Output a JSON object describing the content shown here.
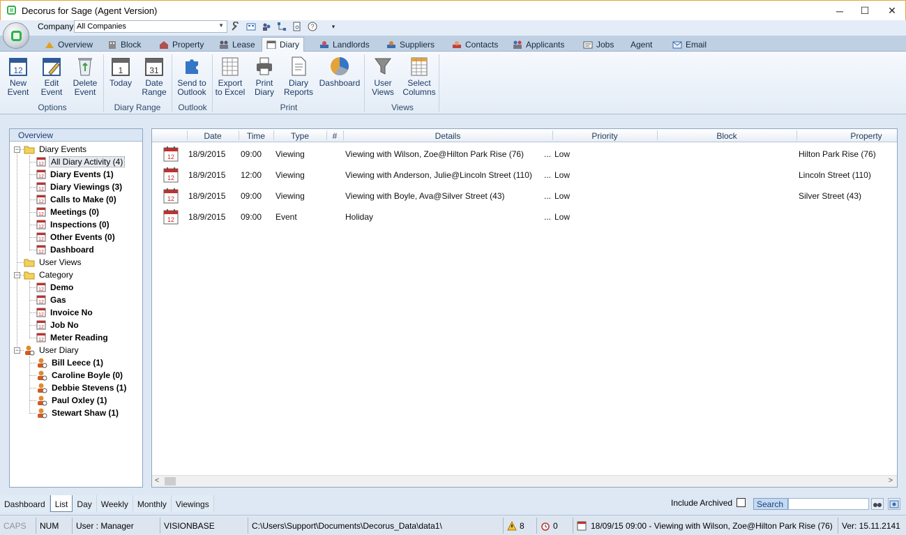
{
  "window": {
    "title": "Decorus for Sage (Agent Version)",
    "minimize": "─",
    "maximize": "☐",
    "close": "✕"
  },
  "company": {
    "label": "Company",
    "value": "All Companies"
  },
  "tabs": [
    "Overview",
    "Block",
    "Property",
    "Lease",
    "Diary",
    "Landlords",
    "Suppliers",
    "Contacts",
    "Applicants",
    "Jobs",
    "Agent",
    "Email"
  ],
  "active_tab": "Diary",
  "ribbon": {
    "buttons": [
      {
        "line1": "New",
        "line2": "Event"
      },
      {
        "line1": "Edit",
        "line2": "Event"
      },
      {
        "line1": "Delete",
        "line2": "Event"
      },
      {
        "line1": "Today",
        "line2": ""
      },
      {
        "line1": "Date",
        "line2": "Range"
      },
      {
        "line1": "Send to",
        "line2": "Outlook"
      },
      {
        "line1": "Export",
        "line2": "to Excel"
      },
      {
        "line1": "Print",
        "line2": "Diary"
      },
      {
        "line1": "Diary",
        "line2": "Reports"
      },
      {
        "line1": "Dashboard",
        "line2": ""
      },
      {
        "line1": "User",
        "line2": "Views"
      },
      {
        "line1": "Select",
        "line2": "Columns"
      }
    ],
    "groups": [
      "Options",
      "Diary Range",
      "Outlook",
      "Print",
      "Views"
    ]
  },
  "tree": {
    "header": "Overview",
    "diary_events": "Diary Events",
    "diary_items": [
      "All Diary Activity (4)",
      "Diary Events (1)",
      "Diary Viewings (3)",
      "Calls to Make (0)",
      "Meetings (0)",
      "Inspections (0)",
      "Other Events (0)",
      "Dashboard"
    ],
    "user_views": "User Views",
    "category": "Category",
    "category_items": [
      "Demo",
      "Gas",
      "Invoice No",
      "Job No",
      "Meter Reading"
    ],
    "user_diary": "User Diary",
    "user_items": [
      "Bill Leece (1)",
      "Caroline Boyle (0)",
      "Debbie Stevens (1)",
      "Paul Oxley (1)",
      "Stewart Shaw (1)"
    ]
  },
  "grid": {
    "columns": [
      "Date",
      "Time",
      "Type",
      "#",
      "Details",
      "Priority",
      "Block",
      "Property"
    ],
    "rows": [
      {
        "date": "18/9/2015",
        "time": "09:00",
        "type": "Viewing",
        "details": "Viewing with Wilson, Zoe@Hilton Park Rise (76)",
        "ell": "...",
        "priority": "Low",
        "block": "",
        "property": "Hilton Park Rise (76)"
      },
      {
        "date": "18/9/2015",
        "time": "12:00",
        "type": "Viewing",
        "details": "Viewing with Anderson, Julie@Lincoln Street (110)",
        "ell": "...",
        "priority": "Low",
        "block": "",
        "property": "Lincoln Street (110)"
      },
      {
        "date": "18/9/2015",
        "time": "09:00",
        "type": "Viewing",
        "details": "Viewing with Boyle, Ava@Silver Street (43)",
        "ell": "...",
        "priority": "Low",
        "block": "",
        "property": "Silver Street (43)"
      },
      {
        "date": "18/9/2015",
        "time": "09:00",
        "type": "Event",
        "details": "Holiday",
        "ell": "...",
        "priority": "Low",
        "block": "",
        "property": ""
      }
    ]
  },
  "bottom_tabs": [
    "Dashboard",
    "List",
    "Day",
    "Weekly",
    "Monthly",
    "Viewings"
  ],
  "active_bottom_tab": "List",
  "include_archived": "Include Archived",
  "search": {
    "label": "Search",
    "value": ""
  },
  "status": {
    "caps": "CAPS",
    "num": "NUM",
    "user": "User : Manager",
    "db": "VISIONBASE",
    "path": "C:\\Users\\Support\\Documents\\Decorus_Data\\data1\\",
    "warnings": "8",
    "alarms": "0",
    "next_event": "18/09/15 09:00 - Viewing with Wilson, Zoe@Hilton Park Rise (76)",
    "version": "Ver: 15.11.2141"
  },
  "colors": {
    "accent": "#1d3c78",
    "ribbon_text": "#1c3a66",
    "window_border": "#e6a43a"
  }
}
